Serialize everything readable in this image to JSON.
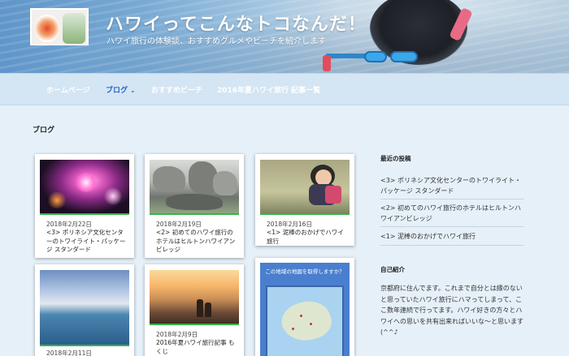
{
  "site": {
    "title": "ハワイってこんなトコなんだ！",
    "tagline": "ハワイ旅行の体験談、おすすめグルメやビーチを紹介します"
  },
  "nav": {
    "items": [
      {
        "label": "ホームページ",
        "active": false
      },
      {
        "label": "ブログ",
        "active": true,
        "chevron": "⌄"
      },
      {
        "label": "おすすめビーチ",
        "active": false
      },
      {
        "label": "2016年夏ハワイ旅行 記事一覧",
        "active": false
      }
    ]
  },
  "main": {
    "heading": "ブログ",
    "posts": [
      {
        "date": "2018年2月22日",
        "title": "<3> ポリネシア文化センターのトワイライト・パッケージ スタンダード",
        "thumb": "night-show"
      },
      {
        "date": "2018年2月19日",
        "title": "<2> 初めてのハワイ旅行のホテルはヒルトンハワイアンビレッジ",
        "thumb": "penguin-rocks"
      },
      {
        "date": "2018年2月16日",
        "title": "<1> 泥棒のおかげでハワイ旅行",
        "thumb": "baby"
      },
      {
        "date": "2018年2月11日",
        "title": "",
        "thumb": "city-from-plane"
      },
      {
        "date": "2018年2月9日",
        "title": "2016年夏ハワイ旅行記事 もくじ",
        "thumb": "sunset-beach"
      }
    ],
    "map_widget": {
      "caption": "この地域の地図を取得しますか？"
    }
  },
  "sidebar": {
    "recent_heading": "最近の投稿",
    "recent_posts": [
      "<3> ポリネシア文化センターのトワイライト・パッケージ スタンダード",
      "<2> 初めてのハワイ旅行のホテルはヒルトンハワイアンビレッジ",
      "<1> 泥棒のおかげでハワイ旅行"
    ],
    "about_heading": "自己紹介",
    "about_text": "京都府に住んでます。これまで自分とは縁のないと思っていたハワイ旅行にハマってしまって、ここ数年連続で行ってます。ハワイ好きの方々とハワイへの思いを共有出来ればいいな〜と思います(^^♪"
  },
  "colors": {
    "accent": "#2563c4",
    "post_bar": "#35b44a"
  }
}
